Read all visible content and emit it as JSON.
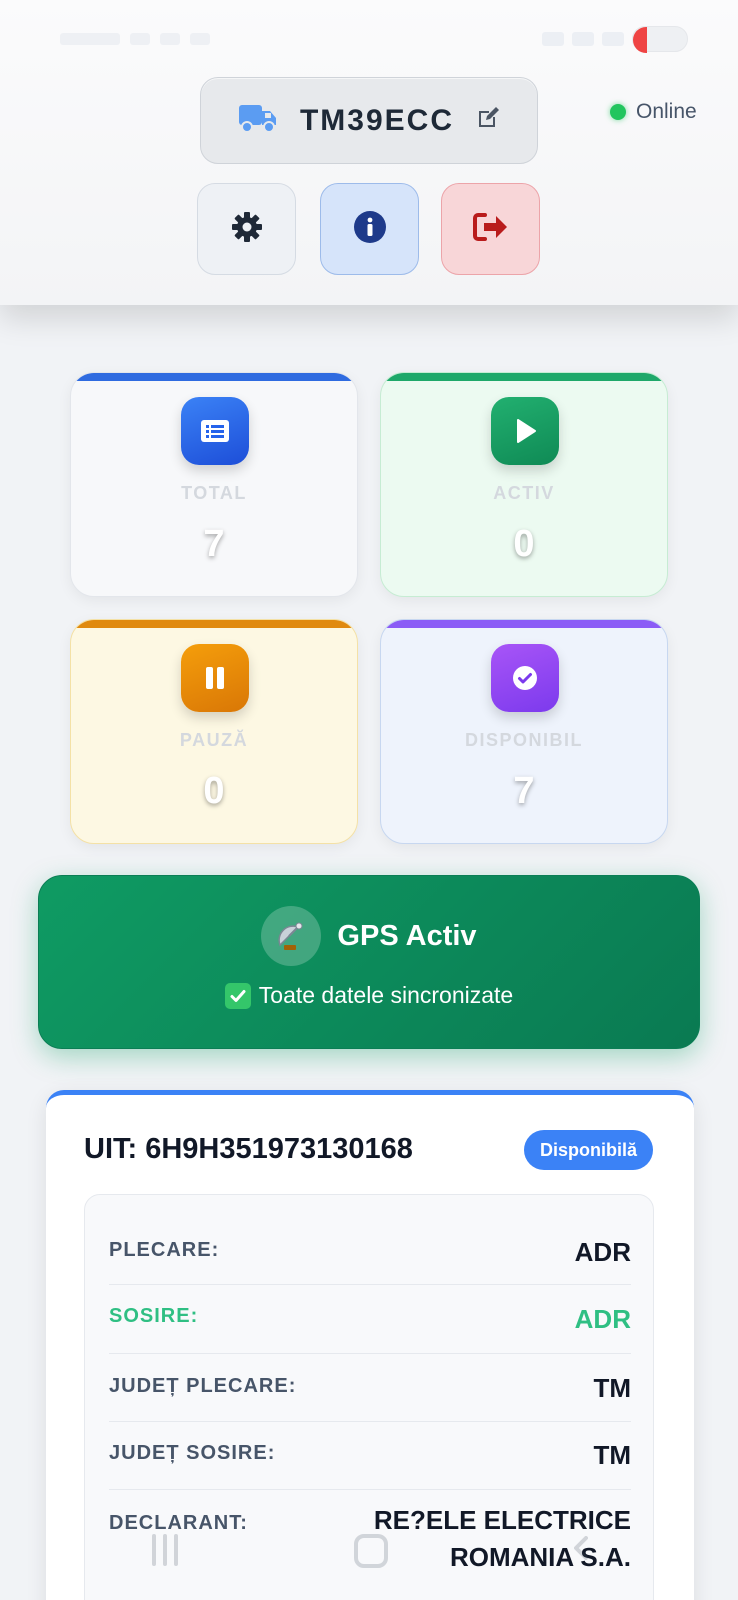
{
  "header": {
    "plate": "TM39ECC",
    "online_label": "Online"
  },
  "stats": [
    {
      "label": "TOTAL",
      "value": "7"
    },
    {
      "label": "ACTIV",
      "value": "0"
    },
    {
      "label": "PAUZĂ",
      "value": "0"
    },
    {
      "label": "DISPONIBIL",
      "value": "7"
    }
  ],
  "gps": {
    "title": "GPS Activ",
    "subtitle": "Toate datele sincronizate"
  },
  "transport": {
    "uit": "UIT: 6H9H351973130168",
    "status": "Disponibilă",
    "rows": [
      {
        "label": "PLECARE:",
        "value": "ADR"
      },
      {
        "label": "SOSIRE:",
        "value": "ADR"
      },
      {
        "label": "JUDEȚ PLECARE:",
        "value": "TM"
      },
      {
        "label": "JUDEȚ SOSIRE:",
        "value": "TM"
      },
      {
        "label": "DECLARANT:",
        "value_line1": "RE?ELE ELECTRICE",
        "value_line2": "ROMANIA S.A."
      }
    ]
  },
  "colors": {
    "accent_blue": "#3b82f6",
    "gps_green": "#0f9b63",
    "online_green": "#22c55e",
    "logout_red": "#b91c1c"
  },
  "icons": [
    "truck-icon",
    "edit-icon",
    "gear-icon",
    "info-icon",
    "logout-icon",
    "list-icon",
    "play-icon",
    "pause-icon",
    "check-circle-icon",
    "satellite-icon",
    "checkbox-icon"
  ]
}
